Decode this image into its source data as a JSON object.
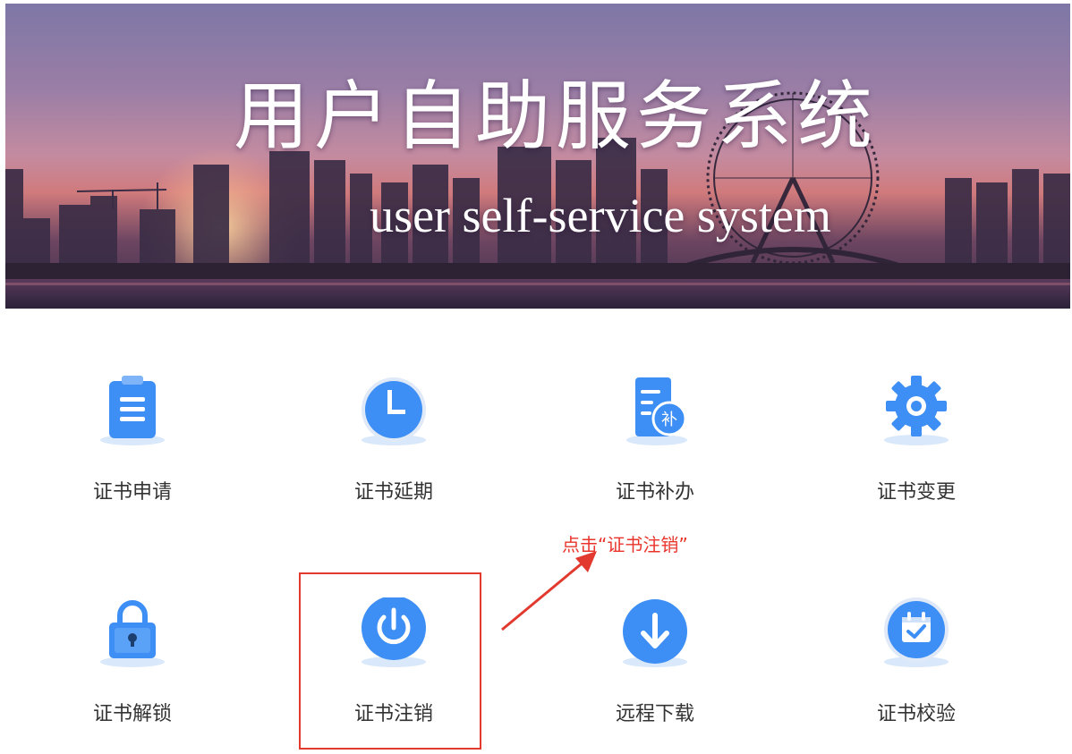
{
  "banner": {
    "title": "用户自助服务系统",
    "subtitle": "user self-service system"
  },
  "tiles": [
    {
      "label": "证书申请",
      "icon": "clipboard-list-icon"
    },
    {
      "label": "证书延期",
      "icon": "clock-icon"
    },
    {
      "label": "证书补办",
      "icon": "document-reissue-icon"
    },
    {
      "label": "证书变更",
      "icon": "gear-icon"
    },
    {
      "label": "证书解锁",
      "icon": "padlock-icon"
    },
    {
      "label": "证书注销",
      "icon": "power-icon"
    },
    {
      "label": "远程下载",
      "icon": "download-icon"
    },
    {
      "label": "证书校验",
      "icon": "calendar-check-icon"
    }
  ],
  "reissue_badge": "补",
  "annotation": {
    "text": "点击“证书注销”"
  },
  "colors": {
    "primary_blue": "#3d8ef5",
    "annotation_red": "#e23a2f",
    "label_text": "#333333"
  }
}
